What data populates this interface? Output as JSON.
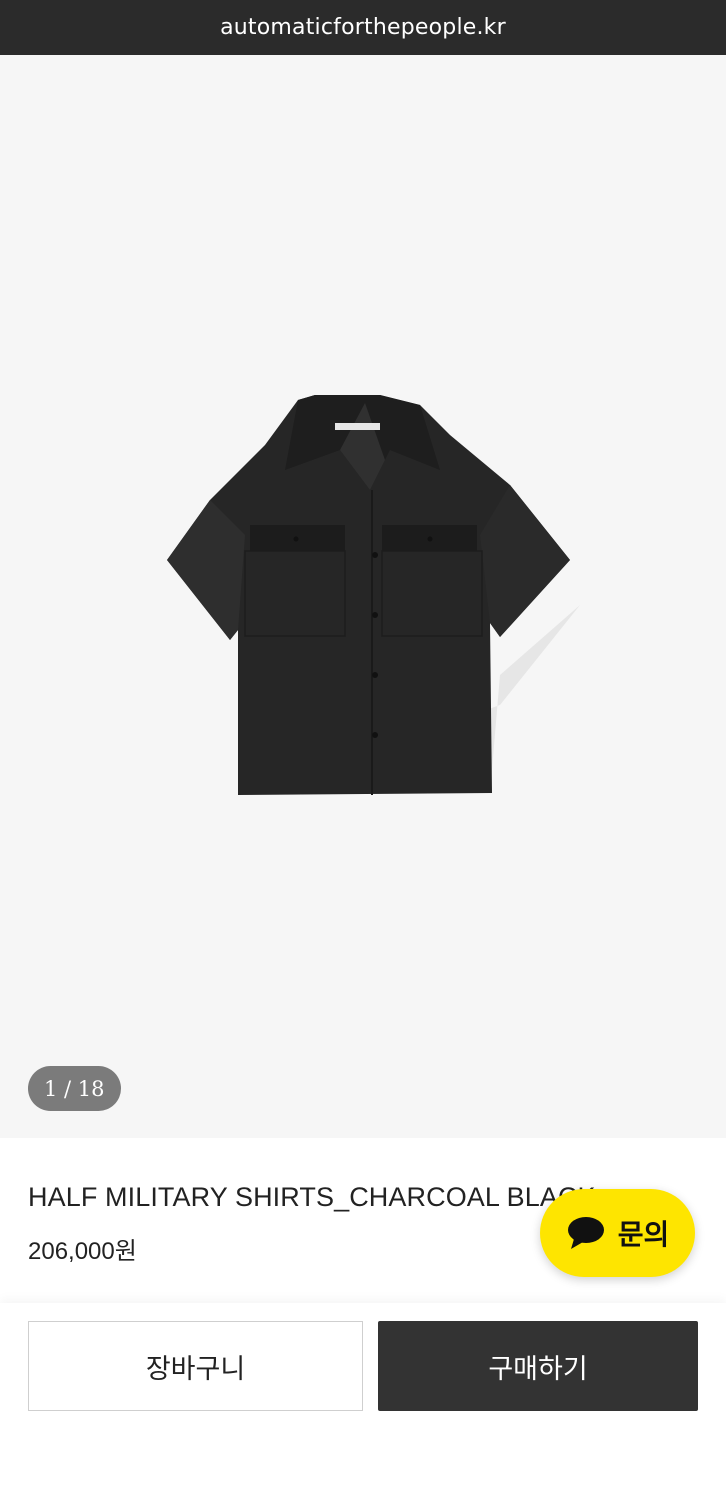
{
  "browser": {
    "url": "automaticforthepeople.kr"
  },
  "gallery": {
    "current_index": 1,
    "total": 18,
    "counter_text": "1 / 18",
    "background_color": "#f6f6f6"
  },
  "product": {
    "name": "HALF MILITARY SHIRTS_CHARCOAL BLACK",
    "price": "206,000원",
    "image_subject": "charcoal-black-short-sleeve-military-shirt"
  },
  "inquiry": {
    "label": "문의",
    "icon": "speech-bubble-icon",
    "color": "#fee500"
  },
  "actions": {
    "cart_label": "장바구니",
    "buy_label": "구매하기",
    "buy_color": "#333333"
  }
}
